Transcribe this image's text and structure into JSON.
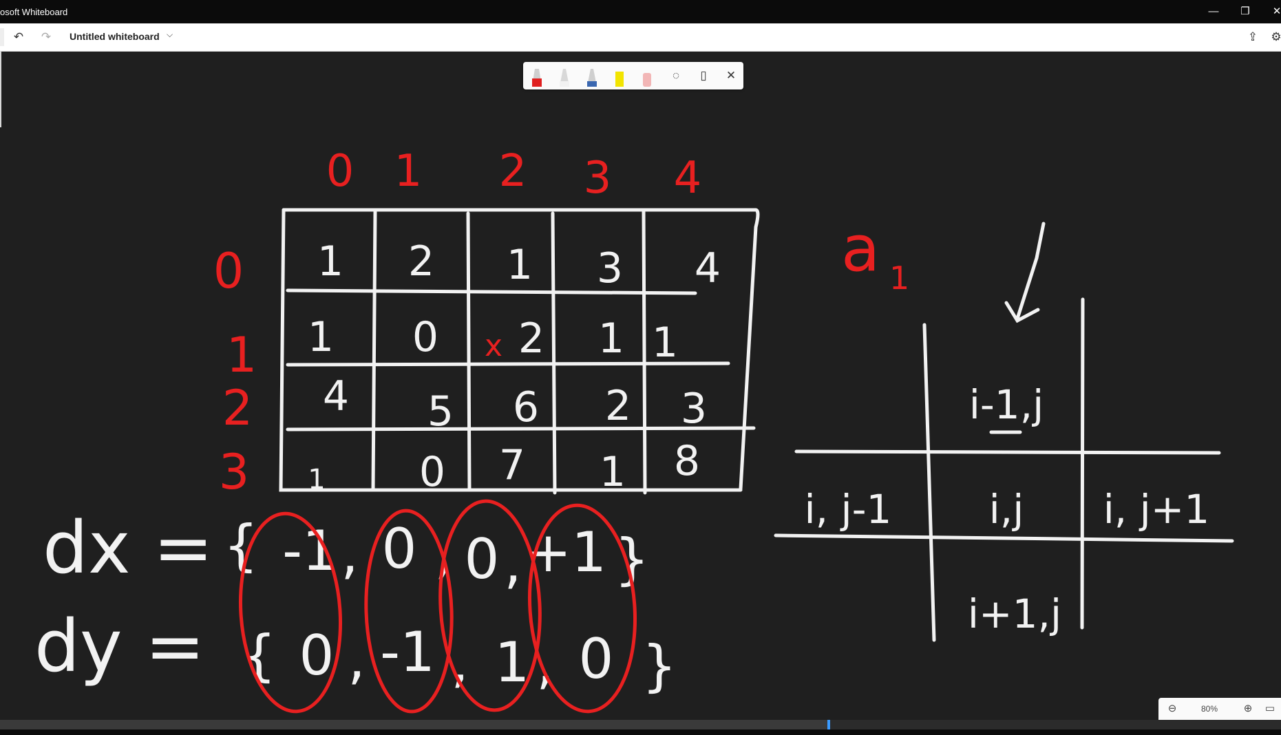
{
  "window": {
    "title": "osoft Whiteboard",
    "minimize_icon": "minimize-icon",
    "restore_icon": "restore-icon",
    "close_icon": "close-icon"
  },
  "toolbar": {
    "undo_icon": "undo-icon",
    "redo_icon": "redo-icon",
    "document_title": "Untitled whiteboard",
    "share_icon": "share-icon",
    "settings_icon": "gear-icon"
  },
  "ink_tools": {
    "pens": [
      {
        "name": "red-pen",
        "color": "#e02020"
      },
      {
        "name": "white-pen",
        "color": "#f2f2f2"
      },
      {
        "name": "blue-pen",
        "color": "#3a67b0"
      },
      {
        "name": "highlighter-yellow",
        "color": "#f2e400"
      },
      {
        "name": "eraser",
        "color": "#f2b6b6"
      }
    ],
    "lasso_icon": "lasso-select-icon",
    "ruler_icon": "ruler-icon",
    "close_icon": "close-icon"
  },
  "zoom": {
    "zoom_out_icon": "zoom-out-icon",
    "zoom_level": "80%",
    "zoom_in_icon": "zoom-in-icon"
  },
  "progress": {
    "fraction": 0.647
  },
  "whiteboard": {
    "column_indices": [
      "0",
      "1",
      "2",
      "3",
      "4"
    ],
    "row_indices": [
      "0",
      "1",
      "2",
      "3"
    ],
    "grid": [
      [
        "1",
        "2",
        "1",
        "3",
        "4"
      ],
      [
        "1",
        "0",
        "2",
        "1",
        "1"
      ],
      [
        "4",
        "5",
        "6",
        "2",
        "3"
      ],
      [
        "1",
        "0",
        "7",
        "1",
        "8"
      ]
    ],
    "marker_x": "x",
    "label_a": "a",
    "label_a_sub": "1",
    "neighbor_top": "i-1,j",
    "neighbor_left": "i, j-1",
    "neighbor_center": "i,j",
    "neighbor_right": "i, j+1",
    "neighbor_bottom": "i+1,j",
    "dx_label": "dx =",
    "dx_values": [
      "{",
      "-1",
      ",",
      "0",
      ",",
      "0",
      ",",
      "+1",
      "}"
    ],
    "dy_label": "dy =",
    "dy_values": [
      "{",
      "0",
      ",",
      "-1",
      ",",
      "1",
      ",",
      "0",
      "}"
    ]
  }
}
